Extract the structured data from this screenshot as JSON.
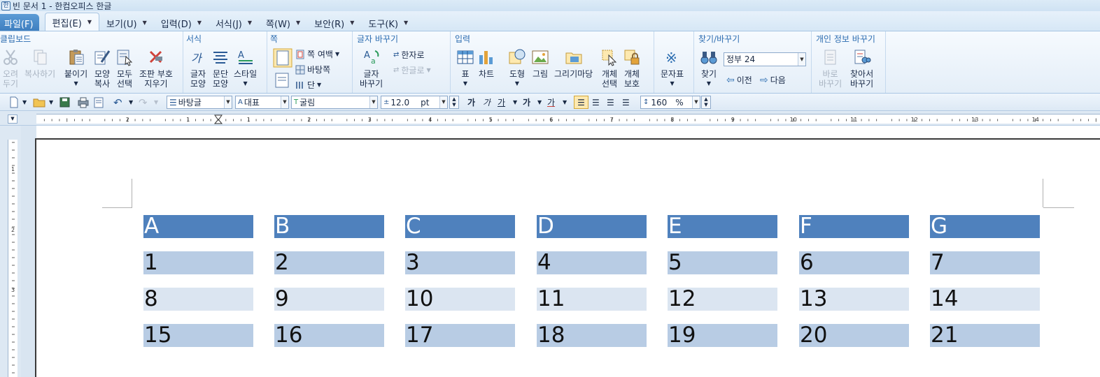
{
  "title_bar": {
    "text": "빈 문서 1 - 한컴오피스 한글"
  },
  "menu": {
    "file": "파일(F)",
    "items": [
      "편집(E)",
      "보기(U)",
      "입력(D)",
      "서식(J)",
      "쪽(W)",
      "보안(R)",
      "도구(K)"
    ]
  },
  "ribbon": {
    "clipboard": {
      "title": "클립보드",
      "cut": [
        "오려",
        "두기"
      ],
      "copy": "복사하기",
      "paste": "붙이기",
      "format_copy": [
        "모양",
        "복사"
      ],
      "select_all": [
        "모두",
        "선택"
      ],
      "remove_compose": [
        "조판 부호",
        "지우기"
      ]
    },
    "format": {
      "title": "서식",
      "char_shape": [
        "글자",
        "모양"
      ],
      "para_shape": [
        "문단",
        "모양"
      ],
      "style": "스타일"
    },
    "page": {
      "title": "쪽",
      "margin": "쪽 여백",
      "background": "바탕쪽",
      "columns": "단"
    },
    "char_replace": {
      "title": "글자 바꾸기",
      "char_convert": [
        "글자",
        "바꾸기"
      ],
      "to_hanja": "한자로",
      "to_hangul": "한글로"
    },
    "insert": {
      "title": "입력",
      "table": "표",
      "chart": "차트",
      "shape": "도형",
      "picture": "그림",
      "drawing_art": "그리기마당",
      "object_select": [
        "개체",
        "선택"
      ],
      "object_protect": [
        "개체",
        "보호"
      ]
    },
    "char_map": {
      "label": "문자표"
    },
    "find": {
      "title": "찾기/바꾸기",
      "find": "찾기",
      "search_value": "정부 24",
      "prev": "이전",
      "next": "다음"
    },
    "privacy": {
      "title": "개인 정보 바꾸기",
      "direct_replace": [
        "바로",
        "바꾸기"
      ],
      "find_replace": [
        "찾아서",
        "바꾸기"
      ]
    }
  },
  "format_bar": {
    "style": "바탕글",
    "language": "대표",
    "font": "굴림",
    "size": "12.0",
    "unit": "pt",
    "bold": "가",
    "italic": "가",
    "underline": "가",
    "strike": "가",
    "color": "가",
    "line_spacing": "160",
    "percent": "%"
  },
  "ruler": {
    "labels": [
      "2",
      "1",
      "1",
      "2",
      "3",
      "4",
      "5",
      "6",
      "7",
      "8",
      "9",
      "10",
      "11",
      "12",
      "13",
      "14"
    ]
  },
  "vruler": {
    "labels": [
      "1",
      "2",
      "3"
    ]
  },
  "table": {
    "header": [
      "A",
      "B",
      "C",
      "D",
      "E",
      "F",
      "G"
    ],
    "rows": [
      [
        "1",
        "2",
        "3",
        "4",
        "5",
        "6",
        "7"
      ],
      [
        "8",
        "9",
        "10",
        "11",
        "12",
        "13",
        "14"
      ],
      [
        "15",
        "16",
        "17",
        "18",
        "19",
        "20",
        "21"
      ]
    ]
  },
  "colors": {
    "header_fill": "#4f81bd",
    "odd_row_fill": "#b8cce4",
    "even_row_fill": "#dbe5f1",
    "ribbon_title": "#2c6cb0"
  }
}
